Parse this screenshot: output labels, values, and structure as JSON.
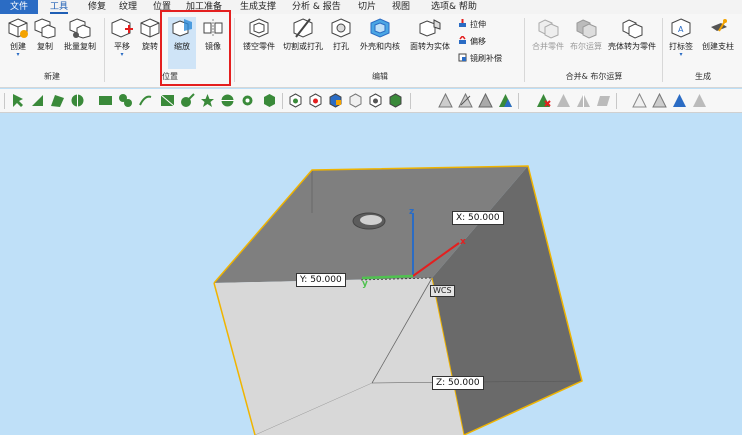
{
  "menubar": {
    "file": "文件",
    "items": [
      "工具",
      "修复",
      "纹理",
      "位置",
      "加工准备",
      "生成支撑",
      "分析 & 报告",
      "切片",
      "视图",
      "选项& 帮助"
    ]
  },
  "ribbon": {
    "new_group": {
      "label": "新建",
      "buttons": [
        "创建",
        "复制",
        "批量复制"
      ]
    },
    "position_group": {
      "label": "位置",
      "buttons": [
        "平移",
        "旋转",
        "缩放",
        "镜像"
      ]
    },
    "edit_group": {
      "label": "编辑",
      "buttons": [
        "镂空零件",
        "切割或打孔",
        "打孔",
        "外壳和内核",
        "面转为实体"
      ],
      "small_buttons": [
        "拉伸",
        "偏移",
        "镜刷补偿"
      ]
    },
    "boolean_group": {
      "label": "合并& 布尔运算",
      "buttons": [
        "合并零件",
        "布尔运算",
        "壳体转为零件"
      ]
    },
    "generate_group": {
      "label": "生成",
      "buttons": [
        "打标签",
        "创建支柱"
      ]
    }
  },
  "viewport": {
    "labels": {
      "x_coord": "X: 50.000",
      "y_coord": "Y: 50.000",
      "z_coord": "Z: 50.000",
      "wcs": "WCS",
      "axis_x": "x",
      "axis_y": "y",
      "axis_z": "z"
    }
  },
  "colors": {
    "accent": "#2b6cc4",
    "highlight": "#e41f1f",
    "viewport_bg": "#bfe0f8",
    "cube_edge": "#f0b400"
  }
}
